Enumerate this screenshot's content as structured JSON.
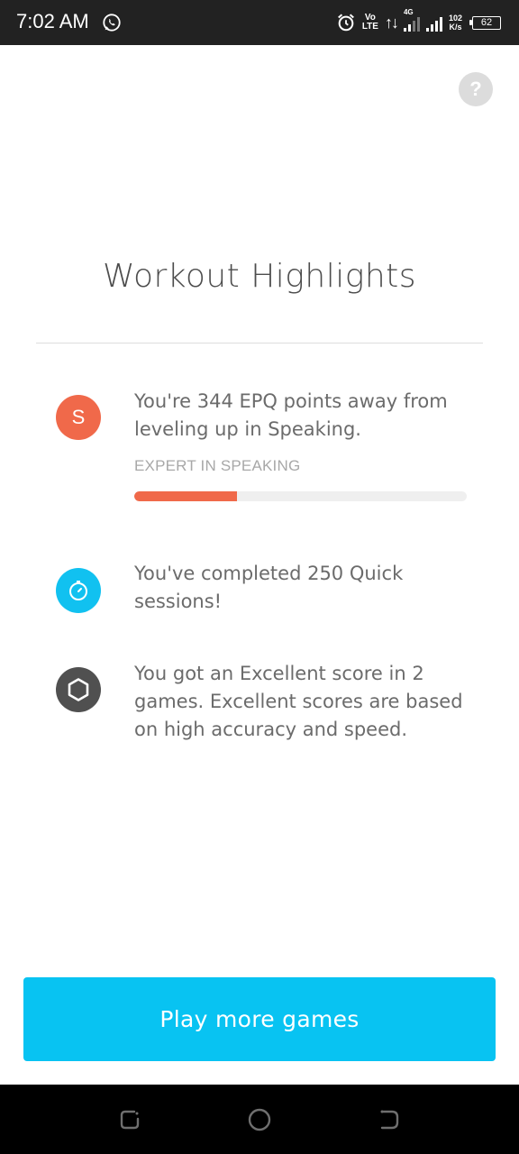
{
  "status_bar": {
    "time": "7:02 AM",
    "whatsapp_icon": "whatsapp-icon",
    "alarm_icon": "alarm-icon",
    "volte_top": "Vo",
    "volte_bottom": "LTE",
    "data_arrows": "↑↓",
    "network_label": "4G",
    "speed_top": "102",
    "speed_bottom": "K/s",
    "battery": "62"
  },
  "help_button": {
    "label": "?"
  },
  "title": "Workout Highlights",
  "highlights": [
    {
      "icon": "S",
      "icon_color": "#f0694a",
      "text": "You're 344 EPQ points away from leveling up in Speaking.",
      "subtitle": "EXPERT IN SPEAKING",
      "progress_percent": 31
    },
    {
      "icon": "stopwatch-icon",
      "icon_color": "#11c1f0",
      "text": "You've completed 250 Quick sessions!"
    },
    {
      "icon": "hexagon-icon",
      "icon_color": "#505050",
      "text": "You got an Excellent score in 2 games. Excellent scores are based on high accuracy and speed."
    }
  ],
  "cta": {
    "label": "Play more games",
    "color": "#08c3f2"
  },
  "nav_bar": {
    "recent_icon": "recent-apps-icon",
    "home_icon": "home-icon",
    "back_icon": "back-icon"
  }
}
